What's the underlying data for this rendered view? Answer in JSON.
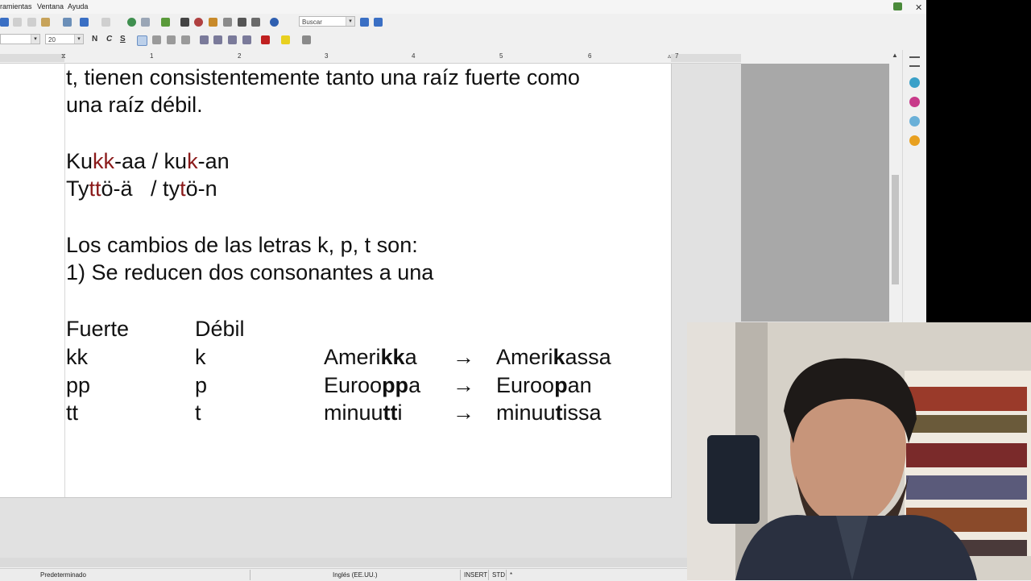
{
  "menu": {
    "items": [
      "ramientas",
      "Ventana",
      "Ayuda"
    ]
  },
  "toolbar": {
    "search_placeholder": "Buscar",
    "font_size": "20",
    "format_labels": [
      "N",
      "C",
      "S"
    ]
  },
  "ruler": {
    "numbers": [
      "1",
      "2",
      "3",
      "4",
      "5",
      "6",
      "7"
    ]
  },
  "document": {
    "line1": "t, tienen consistentemente tanto una raíz fuerte como",
    "line2": "una raíz débil.",
    "ex1": {
      "p1": "Ku",
      "p2": "kk",
      "p3": "-aa / ku",
      "p4": "k",
      "p5": "-an"
    },
    "ex2": {
      "p1": "Ty",
      "p2": "tt",
      "p3": "ö-ä   / ty",
      "p4": "t",
      "p5": "ö-n"
    },
    "line5": "Los cambios de las letras k, p, t son:",
    "line6": "1) Se reducen dos consonantes a una",
    "table": {
      "headers": [
        "Fuerte",
        "Débil"
      ],
      "rows": [
        {
          "strong": "kk",
          "weak": "k",
          "w1a": "Ameri",
          "w1b": "kk",
          "w1c": "a",
          "arrow": "→",
          "w2a": "Ameri",
          "w2b": "k",
          "w2c": "assa"
        },
        {
          "strong": "pp",
          "weak": "p",
          "w1a": "Euroo",
          "w1b": "pp",
          "w1c": "a",
          "arrow": "→",
          "w2a": "Euroo",
          "w2b": "p",
          "w2c": "an"
        },
        {
          "strong": "tt",
          "weak": "t",
          "w1a": "minuu",
          "w1b": "tt",
          "w1c": "i",
          "arrow": "→",
          "w2a": "minuu",
          "w2b": "t",
          "w2c": "issa"
        }
      ]
    }
  },
  "status": {
    "page_style": "Predeterminado",
    "language": "Inglés (EE.UU.)",
    "insert": "INSERT",
    "std": "STD",
    "star": "*"
  },
  "colors": {
    "highlight_red": "#8b1a1a"
  }
}
